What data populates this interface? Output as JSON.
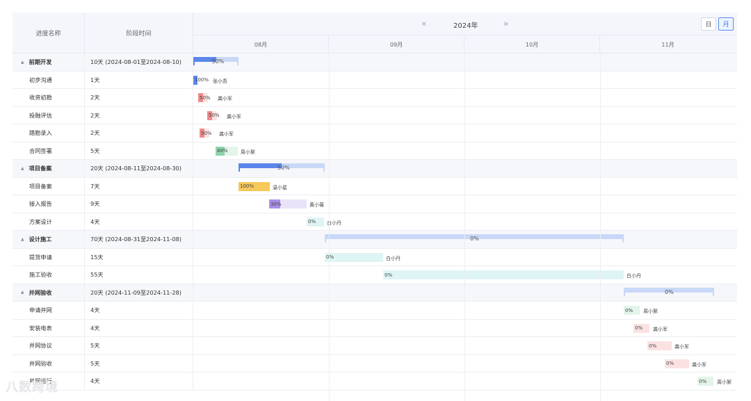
{
  "header": {
    "name_col": "进度名称",
    "time_col": "阶段时间",
    "prev_nav": "«",
    "next_nav": "»",
    "year": "2024年",
    "view_day": "日",
    "view_month": "月",
    "months": [
      "08月",
      "09月",
      "10月",
      "11月"
    ]
  },
  "rows": [
    {
      "name": "前期开发",
      "time": "10天 (2024-08-01至2024-08-10)",
      "group": true,
      "progress": "50%"
    },
    {
      "name": "初步沟通",
      "time": "1天",
      "progress": "100%",
      "owner": "张小吾",
      "color": "#5b86ea",
      "fill": 1.0
    },
    {
      "name": "收资初勘",
      "time": "2天",
      "progress": "50%",
      "owner": "龚小军",
      "color": "#ef8a8a",
      "fill": 0.5
    },
    {
      "name": "投融评估",
      "time": "2天",
      "progress": "50%",
      "owner": "龚小军",
      "color": "#ef8a8a",
      "fill": 0.5
    },
    {
      "name": "踏勘录入",
      "time": "2天",
      "progress": "50%",
      "owner": "龚小军",
      "color": "#ef8a8a",
      "fill": 0.5
    },
    {
      "name": "合同签署",
      "time": "5天",
      "progress": "40%",
      "owner": "周小絮",
      "color": "#8fd4ad",
      "fill": 0.4
    },
    {
      "name": "项目备案",
      "time": "20天 (2024-08-11至2024-08-30)",
      "group": true,
      "progress": "50%"
    },
    {
      "name": "项目备案",
      "time": "7天",
      "progress": "100%",
      "owner": "温小星",
      "color": "#f7c85a",
      "fill": 1.0
    },
    {
      "name": "接入报告",
      "time": "9天",
      "progress": "30%",
      "owner": "黄小菊",
      "color": "#a98ee8",
      "fill": 0.3
    },
    {
      "name": "方案设计",
      "time": "4天",
      "progress": "0%",
      "owner": "白小丹",
      "color": "#7fd5d5",
      "fill": 0
    },
    {
      "name": "设计施工",
      "time": "70天 (2024-08-31至2024-11-08)",
      "group": true,
      "progress": "0%"
    },
    {
      "name": "提货申请",
      "time": "15天",
      "progress": "0%",
      "owner": "白小丹",
      "color": "#7fd5d5",
      "fill": 0
    },
    {
      "name": "施工验收",
      "time": "55天",
      "progress": "0%",
      "owner": "白小丹",
      "color": "#7fd5d5",
      "fill": 0
    },
    {
      "name": "并网验收",
      "time": "20天 (2024-11-09至2024-11-28)",
      "group": true,
      "progress": "0%"
    },
    {
      "name": "申请并网",
      "time": "4天",
      "progress": "0%",
      "owner": "周小絮",
      "color": "#8fd4ad",
      "fill": 0
    },
    {
      "name": "安装电表",
      "time": "4天",
      "progress": "0%",
      "owner": "龚小军",
      "color": "#ef8a8a",
      "fill": 0
    },
    {
      "name": "并网协议",
      "time": "5天",
      "progress": "0%",
      "owner": "龚小军",
      "color": "#ef8a8a",
      "fill": 0
    },
    {
      "name": "并网验收",
      "time": "5天",
      "progress": "0%",
      "owner": "龚小军",
      "color": "#ef8a8a",
      "fill": 0
    },
    {
      "name": "并网运行",
      "time": "4天",
      "progress": "0%",
      "owner": "周小絮",
      "color": "#8fd4ad",
      "fill": 0
    }
  ],
  "watermark": "八数跨境"
}
